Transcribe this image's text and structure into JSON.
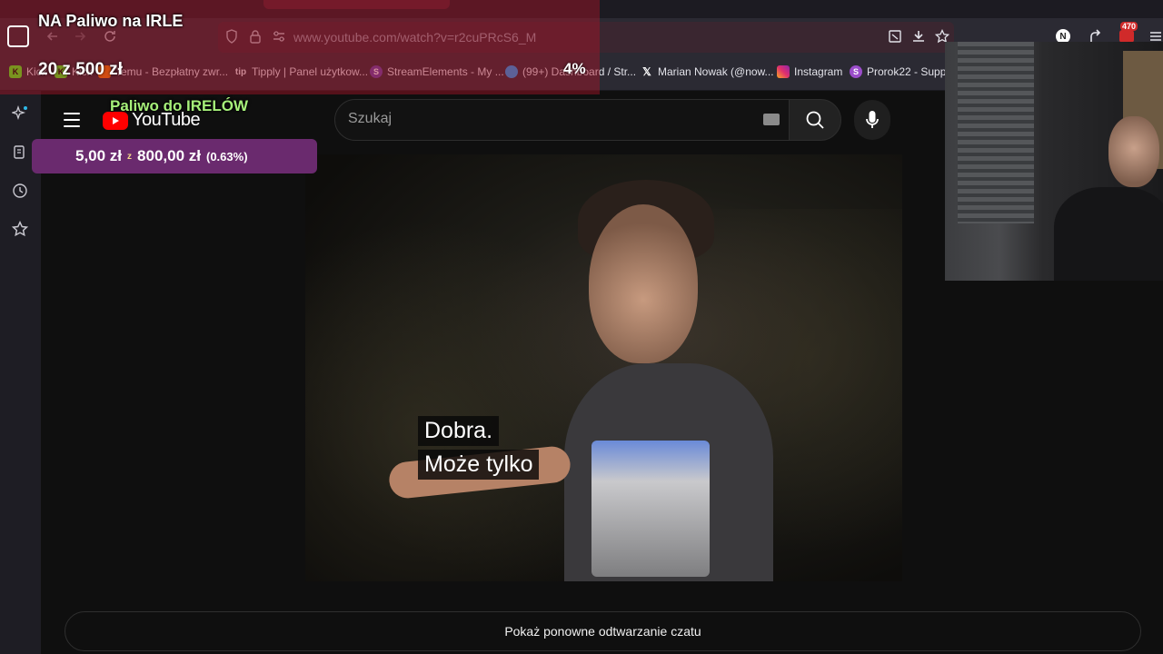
{
  "browser": {
    "url": "www.youtube.com/watch?v=r2cuPRcS6_M",
    "badge_count": "470",
    "bookmarks": [
      {
        "label": "Kick",
        "icon": "kick-icon",
        "color": "#53fc18"
      },
      {
        "label": "Kick",
        "icon": "kick-icon",
        "color": "#53fc18"
      },
      {
        "label": "Temu - Bezpłatny zwr...",
        "icon": "temu-icon",
        "color": "#f57c00"
      },
      {
        "label": "Tipply | Panel użytkow...",
        "icon": "tipply-icon",
        "color": "#6b5bd6"
      },
      {
        "label": "StreamElements - My ...",
        "icon": "streamelements-icon",
        "color": "#6441a5"
      },
      {
        "label": "(99+) Dashboard / Str...",
        "icon": "dashboard-icon",
        "color": "#1da1f2"
      },
      {
        "label": "Marian Nowak (@now...",
        "icon": "x-icon",
        "color": "#000000"
      },
      {
        "label": "Instagram",
        "icon": "instagram-icon",
        "color": "#e1306c"
      },
      {
        "label": "Prorok22 - Suppi",
        "icon": "prorok-icon",
        "color": "#9b4dca"
      }
    ]
  },
  "overlay": {
    "title": "NA Paliwo na IRLE",
    "goal_text": "20 z 500 zł",
    "percent": "4%",
    "paliwo_label": "Paliwo do IRELÓW"
  },
  "donation": {
    "amount": "5,00 zł",
    "separator": "z",
    "target": "800,00 zł",
    "percent": "(0.63%)"
  },
  "youtube": {
    "logo_text": "YouTube",
    "search_placeholder": "Szukaj",
    "caption_line1": "Dobra.",
    "caption_line2": "Może tylko",
    "chat_replay": "Pokaż ponowne odtwarzanie czatu"
  },
  "colors": {
    "youtube_red": "#ff0000",
    "overlay_red": "#aa1428",
    "donation_purple": "#6a2a6e",
    "paliwo_green": "#a6f07a"
  }
}
